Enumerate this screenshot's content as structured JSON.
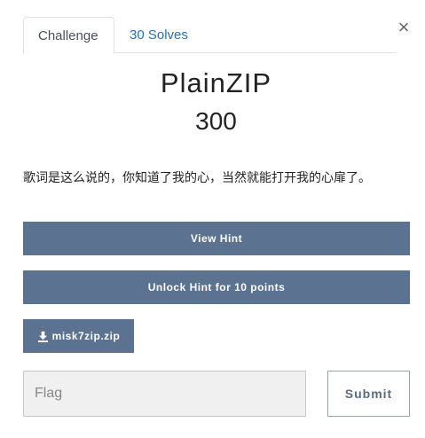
{
  "tabs": [
    {
      "label": "Challenge",
      "active": true
    },
    {
      "label": "30 Solves",
      "active": false
    }
  ],
  "close_icon": "close-icon",
  "challenge": {
    "name": "PlainZIP",
    "points": "300",
    "description": "歌词是这么说的，你知道了我的心，当然就能打开我的心扉了。"
  },
  "buttons": {
    "view_hint": "View Hint",
    "unlock_hint": "Unlock Hint for 10 points",
    "file": "misk7zip.zip",
    "file_icon": "download-icon"
  },
  "flag": {
    "placeholder": "Flag",
    "value": ""
  },
  "submit_label": "Submit",
  "colors": {
    "button_bg": "#5b7290",
    "tab_link": "#2a6fad"
  }
}
